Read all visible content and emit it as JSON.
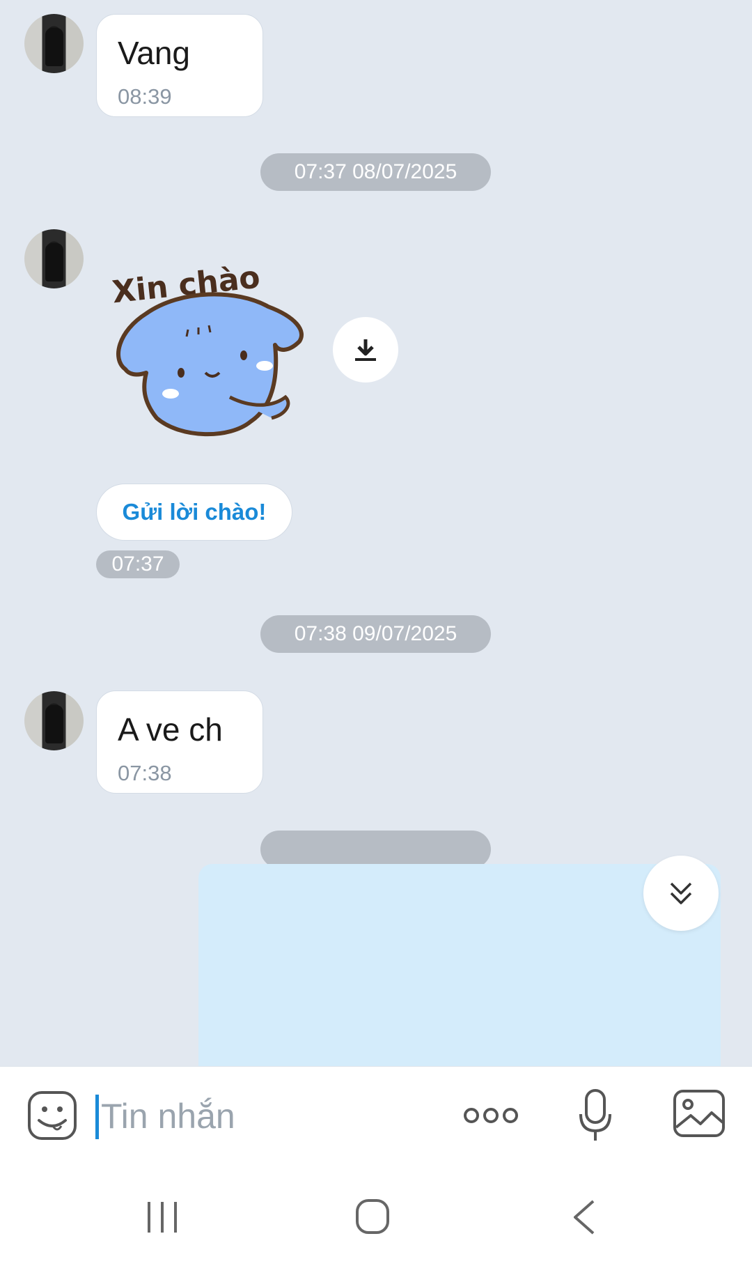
{
  "messages": [
    {
      "text": "Vang",
      "time": "08:39"
    },
    {
      "text": "A ve ch",
      "time": "07:38"
    }
  ],
  "date_separators": [
    "07:37 08/07/2025",
    "07:38 09/07/2025"
  ],
  "sticker": {
    "text": "Xin chào"
  },
  "greet_button": {
    "label": "Gửi lời chào!",
    "time": "07:37"
  },
  "input": {
    "placeholder": "Tin nhắn"
  },
  "icons": {
    "download": "download-icon",
    "scroll": "double-chevron-down-icon",
    "emoji": "emoji-icon",
    "more": "more-icon",
    "mic": "microphone-icon",
    "image": "image-icon",
    "recents": "recents-icon",
    "home": "home-icon",
    "back": "back-icon"
  },
  "colors": {
    "background": "#e2e8f0",
    "accent": "#1a8ad8",
    "pill": "#b6bcc4",
    "own_bubble": "#d4ecfb"
  }
}
